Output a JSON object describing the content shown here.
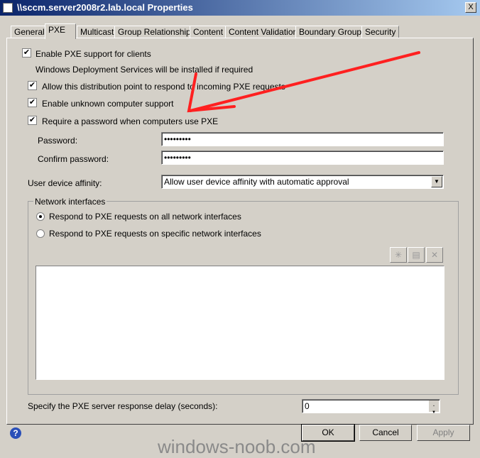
{
  "window": {
    "title": "\\\\sccm.server2008r2.lab.local Properties",
    "close": "X"
  },
  "tabs": [
    {
      "label": "General"
    },
    {
      "label": "PXE"
    },
    {
      "label": "Multicast"
    },
    {
      "label": "Group Relationships"
    },
    {
      "label": "Content"
    },
    {
      "label": "Content Validation"
    },
    {
      "label": "Boundary Groups"
    },
    {
      "label": "Security"
    }
  ],
  "active_tab": "PXE",
  "pxe": {
    "enable_pxe": {
      "label": "Enable PXE support for clients",
      "checked": true
    },
    "wds_note": "Windows Deployment Services will be installed if required",
    "allow_respond": {
      "label": "Allow this distribution point to respond to incoming PXE requests",
      "checked": true
    },
    "unknown_support": {
      "label": "Enable unknown computer support",
      "checked": true
    },
    "require_password": {
      "label": "Require a password when computers use PXE",
      "checked": true
    },
    "password_label": "Password:",
    "password_value": "•••••••••",
    "confirm_label": "Confirm password:",
    "confirm_value": "•••••••••",
    "affinity_label": "User device affinity:",
    "affinity_value": "Allow user device affinity with automatic approval",
    "network_group": "Network interfaces",
    "radio_all": {
      "label": "Respond to PXE requests on all network interfaces",
      "selected": true
    },
    "radio_specific": {
      "label": "Respond to PXE requests on specific network interfaces",
      "selected": false
    },
    "delay_label": "Specify the PXE server response delay (seconds):",
    "delay_value": "0"
  },
  "buttons": {
    "ok": "OK",
    "cancel": "Cancel",
    "apply": "Apply"
  },
  "watermark": "windows-noob.com",
  "annotation_color": "#ff2020"
}
